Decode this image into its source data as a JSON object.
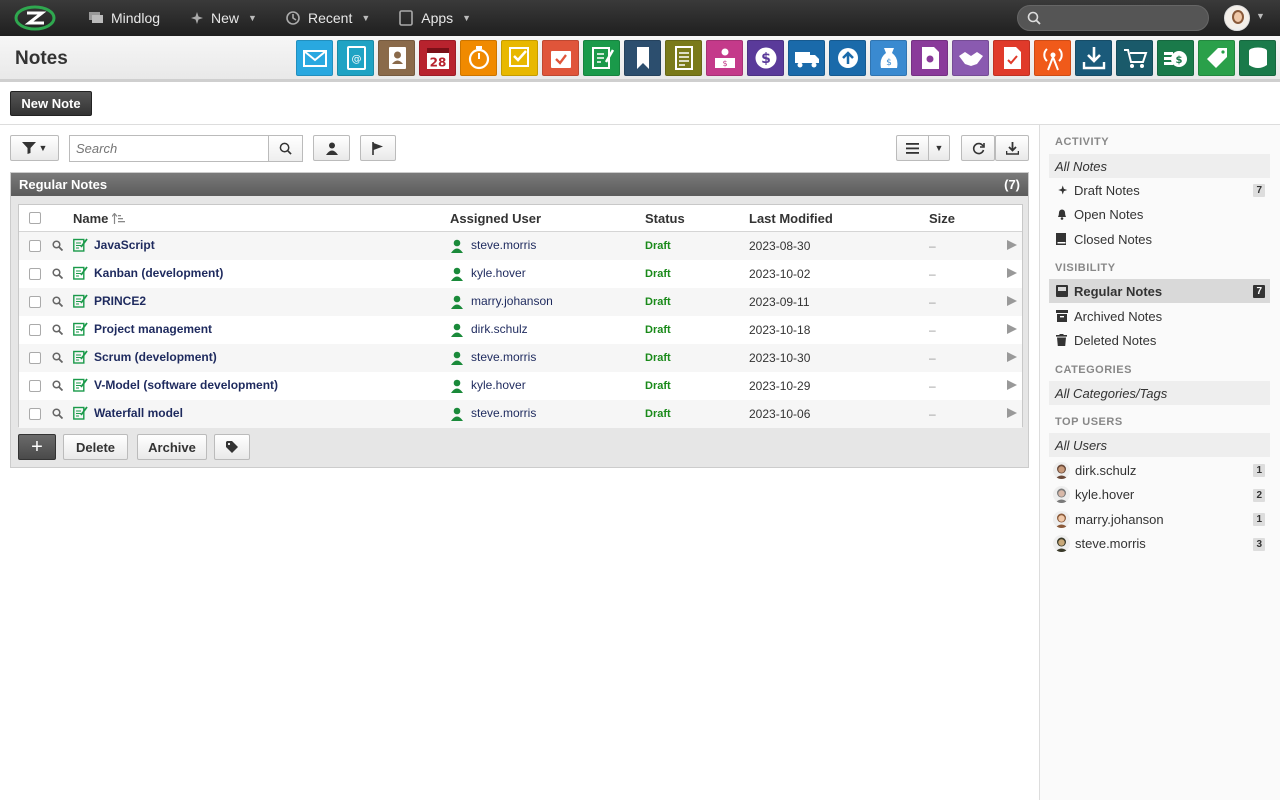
{
  "topbar": {
    "app_name": "Mindlog",
    "new_label": "New",
    "recent_label": "Recent",
    "apps_label": "Apps",
    "search_placeholder": ""
  },
  "header": {
    "title": "Notes",
    "apps": [
      {
        "name": "mail",
        "color": "#29a8e0"
      },
      {
        "name": "addressbook",
        "color": "#1fa3c4"
      },
      {
        "name": "contacts",
        "color": "#8a6a4a"
      },
      {
        "name": "calendar",
        "color": "#b8232e",
        "text": "28"
      },
      {
        "name": "timer",
        "color": "#f08a00"
      },
      {
        "name": "tasks",
        "color": "#e8b800"
      },
      {
        "name": "projects",
        "color": "#e0553a"
      },
      {
        "name": "notes",
        "color": "#1a9a4a"
      },
      {
        "name": "bookmarks",
        "color": "#2c4e6e"
      },
      {
        "name": "documents",
        "color": "#7a7a1a"
      },
      {
        "name": "helpdesk",
        "color": "#c43a8a"
      },
      {
        "name": "finance",
        "color": "#5a3a9a"
      },
      {
        "name": "shipping",
        "color": "#1a6aaa"
      },
      {
        "name": "sync",
        "color": "#1a6aaa"
      },
      {
        "name": "sales",
        "color": "#3a8ad0"
      },
      {
        "name": "licenses",
        "color": "#8a3a9a"
      },
      {
        "name": "deals",
        "color": "#8a5ab0"
      },
      {
        "name": "pdf",
        "color": "#e03a2a"
      },
      {
        "name": "broadcast",
        "color": "#f05a1a"
      },
      {
        "name": "downloads",
        "color": "#1a5a7a"
      },
      {
        "name": "shop",
        "color": "#1a5a6a"
      },
      {
        "name": "money",
        "color": "#1a7a4a"
      },
      {
        "name": "price-tags",
        "color": "#2aa04a"
      },
      {
        "name": "database",
        "color": "#1a7a4a"
      }
    ]
  },
  "new_note_label": "New Note",
  "toolbar": {
    "search_placeholder": "Search"
  },
  "panel": {
    "title": "Regular Notes",
    "count": "(7)",
    "columns": {
      "name": "Name",
      "user": "Assigned User",
      "status": "Status",
      "modified": "Last Modified",
      "size": "Size"
    },
    "rows": [
      {
        "name": "JavaScript",
        "user": "steve.morris",
        "status": "Draft",
        "modified": "2023-08-30",
        "size": "–"
      },
      {
        "name": "Kanban (development)",
        "user": "kyle.hover",
        "status": "Draft",
        "modified": "2023-10-02",
        "size": "–"
      },
      {
        "name": "PRINCE2",
        "user": "marry.johanson",
        "status": "Draft",
        "modified": "2023-09-11",
        "size": "–"
      },
      {
        "name": "Project management",
        "user": "dirk.schulz",
        "status": "Draft",
        "modified": "2023-10-18",
        "size": "–"
      },
      {
        "name": "Scrum (development)",
        "user": "steve.morris",
        "status": "Draft",
        "modified": "2023-10-30",
        "size": "–"
      },
      {
        "name": "V-Model (software development)",
        "user": "kyle.hover",
        "status": "Draft",
        "modified": "2023-10-29",
        "size": "–"
      },
      {
        "name": "Waterfall model",
        "user": "steve.morris",
        "status": "Draft",
        "modified": "2023-10-06",
        "size": "–"
      }
    ],
    "add_label": "+",
    "delete_label": "Delete",
    "archive_label": "Archive"
  },
  "sidebar": {
    "activity_title": "ACTIVITY",
    "all_notes": "All Notes",
    "draft_notes": "Draft Notes",
    "draft_count": "7",
    "open_notes": "Open Notes",
    "closed_notes": "Closed Notes",
    "visibility_title": "VISIBILITY",
    "regular_notes": "Regular Notes",
    "regular_count": "7",
    "archived_notes": "Archived Notes",
    "deleted_notes": "Deleted Notes",
    "categories_title": "CATEGORIES",
    "all_categories": "All Categories/Tags",
    "top_users_title": "TOP USERS",
    "all_users": "All Users",
    "users": [
      {
        "name": "dirk.schulz",
        "count": "1"
      },
      {
        "name": "kyle.hover",
        "count": "2"
      },
      {
        "name": "marry.johanson",
        "count": "1"
      },
      {
        "name": "steve.morris",
        "count": "3"
      }
    ]
  }
}
